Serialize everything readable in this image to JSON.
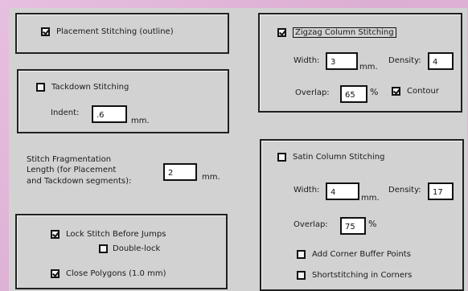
{
  "placement": {
    "label": "Placement Stitching (outline)",
    "checked": true
  },
  "tackdown": {
    "label": "Tackdown Stitching",
    "checked": false,
    "indent_label": "Indent:",
    "indent_value": ".6",
    "indent_unit": "mm."
  },
  "fragmentation": {
    "line1": "Stitch Fragmentation",
    "line2": "Length  (for Placement",
    "line3": "and Tackdown segments):",
    "value": "2",
    "unit": "mm."
  },
  "lock_group": {
    "lock_stitch": {
      "label": "Lock Stitch Before Jumps",
      "checked": true
    },
    "double_lock": {
      "label": "Double-lock",
      "checked": false
    },
    "close_polygons": {
      "label": "Close Polygons (1.0 mm)",
      "checked": true
    }
  },
  "zigzag": {
    "label": "Zigzag Column Stitching",
    "checked": true,
    "width_label": "Width:",
    "width_value": "3",
    "width_unit": "mm.",
    "density_label": "Density:",
    "density_value": "4",
    "overlap_label": "Overlap:",
    "overlap_value": "65",
    "overlap_unit": "%",
    "contour": {
      "label": "Contour",
      "checked": true
    }
  },
  "satin": {
    "label": "Satin Column Stitching",
    "checked": false,
    "width_label": "Width:",
    "width_value": "4",
    "width_unit": "mm.",
    "density_label": "Density:",
    "density_value": "17",
    "overlap_label": "Overlap:",
    "overlap_value": "75",
    "overlap_unit": "%",
    "corner_buffer": {
      "label": "Add Corner Buffer Points",
      "checked": false
    },
    "shortstitching": {
      "label": "Shortstitching in Corners",
      "checked": false
    }
  }
}
